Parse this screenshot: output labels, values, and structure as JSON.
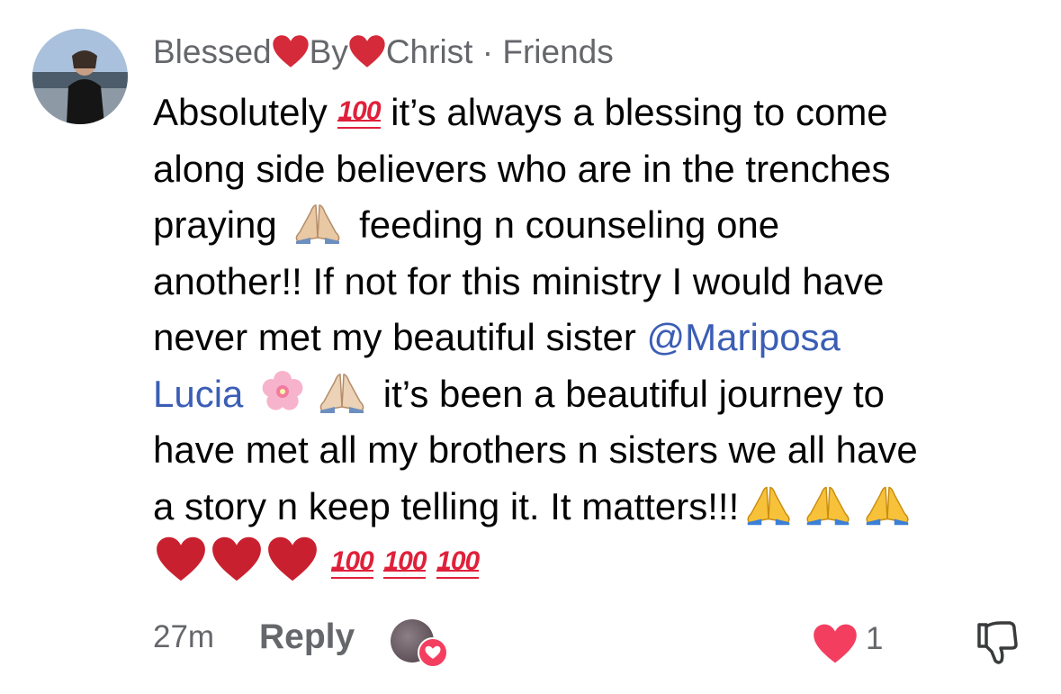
{
  "comment": {
    "author_part1": "Blessed",
    "author_part2": "By",
    "author_part3": "Christ",
    "separator": " · ",
    "relationship": "Friends",
    "lines": {
      "l1a": "Absolutely",
      "l1b": " it’s always a blessing to come",
      "l2": "along side believers who are in the trenches",
      "l3a": "praying",
      "l3b": " feeding n counseling one",
      "l4": "another!! If not for this ministry I would have",
      "l5a": "never met my beautiful sister ",
      "mention_a": "@Mariposa",
      "mention_b": "Lucia",
      "l6b": " it’s been a beautiful journey to",
      "l7": "have met all my brothers n sisters we all have",
      "l8": "a story n keep telling it. It matters!!!"
    },
    "hundred_label": "100"
  },
  "footer": {
    "time": "27m",
    "reply_label": "Reply",
    "like_count": "1"
  },
  "icons": {
    "heart": "red-heart-icon",
    "pray": "folded-hands-icon",
    "flower": "cherry-blossom-icon",
    "hundred": "hundred-points-icon",
    "dislike": "thumbs-down-icon"
  },
  "colors": {
    "mention": "#3b5eb5",
    "heart": "#d42a3a",
    "like": "#f43e60",
    "meta": "#65676b"
  }
}
